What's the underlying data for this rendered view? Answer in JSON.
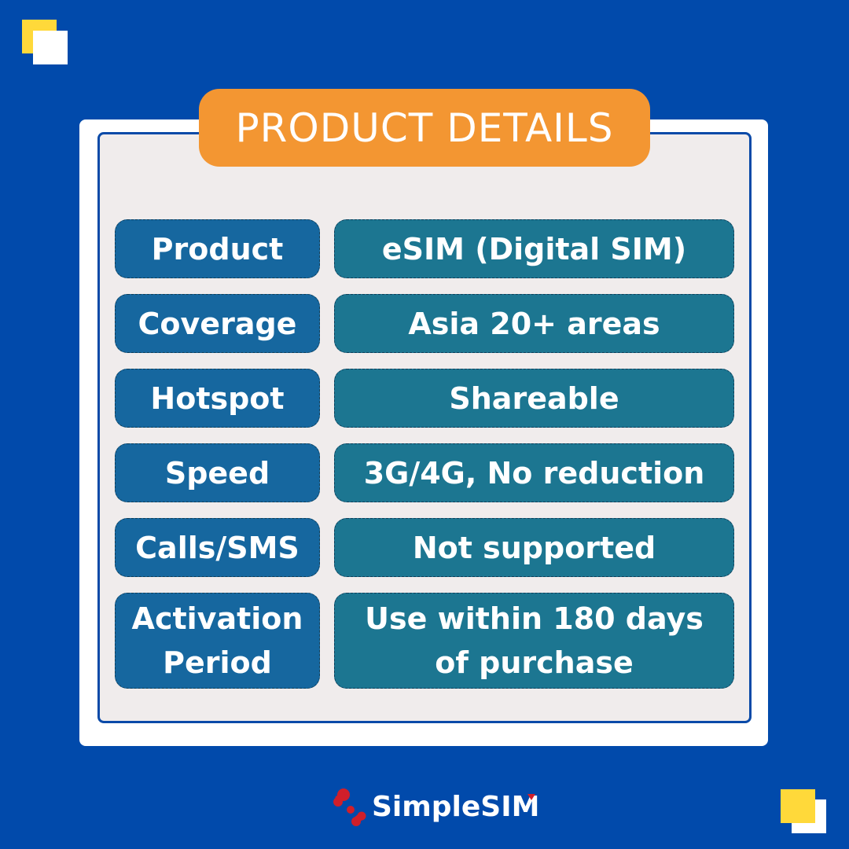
{
  "title": "PRODUCT DETAILS",
  "details": [
    {
      "label": "Product",
      "value": "eSIM (Digital SIM)"
    },
    {
      "label": "Coverage",
      "value": "Asia 20+ areas"
    },
    {
      "label": "Hotspot",
      "value": "Shareable"
    },
    {
      "label": "Speed",
      "value": "3G/4G, No reduction"
    },
    {
      "label": "Calls/SMS",
      "value": "Not supported"
    },
    {
      "label": "Activation\nPeriod",
      "value": "Use within 180 days\nof purchase"
    }
  ],
  "brand": {
    "name": "SimpleSIM",
    "logo_icon": "simplesim-dots-logo-icon"
  },
  "colors": {
    "background": "#014aab",
    "accent_orange": "#f39632",
    "label_blue": "#16679f",
    "value_teal": "#1c7691",
    "yellow": "#ffd93a",
    "logo_red": "#d01f2a"
  }
}
